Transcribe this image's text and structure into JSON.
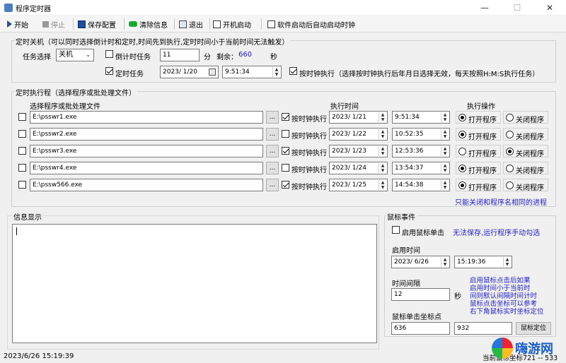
{
  "window": {
    "title": "程序定时器",
    "min": "—",
    "max": "☐",
    "close": "✕"
  },
  "toolbar": {
    "start": "开始",
    "stop": "停止",
    "save": "保存配置",
    "clear": "清除信息",
    "exit": "退出",
    "boot_start": "开机启动",
    "auto_start": "软件启动后自动启动时钟"
  },
  "shutdown": {
    "group_label": "定时关机（可以同时选择倒计时和定时,时间先到执行,定时时间小于当前时间无法触发）",
    "task_label": "任务选择",
    "task_value": "关机",
    "countdown_label": "倒计时任务",
    "countdown_value": "11",
    "unit_min": "分",
    "remain_label": "剩余：",
    "remain_value": "660",
    "unit_sec": "秒",
    "timed_label": "定时任务",
    "date": "2023/ 1/20",
    "time": "9:51:34",
    "clock_exec_label": "按时钟执行（选择按时钟执行后年月日选择无效，每天按照H:M:S执行任务）"
  },
  "program": {
    "group_label": "定时执行程（选择程序或批处理文件）",
    "col_file": "选择程序或批处理文件",
    "col_time": "执行时间",
    "col_action": "执行操作",
    "browse": "...",
    "clock_label": "按时钟执行",
    "open_label": "打开程序",
    "close_label": "关闭程序",
    "rows": [
      {
        "path": "E:\\psswr1.exe",
        "clock": true,
        "date": "2023/ 1/21",
        "time": "9:51:34",
        "action": "open"
      },
      {
        "path": "E:\\psswr2.exe",
        "clock": false,
        "date": "2023/ 1/22",
        "time": "10:52:35",
        "action": "open"
      },
      {
        "path": "E:\\psswr3.exe",
        "clock": true,
        "date": "2023/ 1/23",
        "time": "12:53:36",
        "action": "close"
      },
      {
        "path": "E:\\psswr4.exe",
        "clock": false,
        "date": "2023/ 1/24",
        "time": "13:54:37",
        "action": "open"
      },
      {
        "path": "E:\\pssw566.exe",
        "clock": true,
        "date": "2023/ 1/25",
        "time": "14:54:38",
        "action": "open"
      }
    ],
    "note": "只能关闭和程序名相同的进程"
  },
  "info": {
    "label": "信息显示"
  },
  "mouse": {
    "group_label": "鼠标事件",
    "enable_label": "启用鼠标单击",
    "enable_note": "无法保存,运行程序手动勾选",
    "start_time_label": "启用时间",
    "date": "2023/ 6/26",
    "time": "15:19:36",
    "interval_label": "时间间隔",
    "interval_value": "12",
    "unit_sec": "秒",
    "hint": [
      "启用鼠标点击后如果",
      "启用时间小于当前时",
      "间则默认间隔时间计时",
      "鼠标点击坐标可以参考",
      "右下角鼠标实时坐标定位"
    ],
    "coord_label": "鼠标单击坐标点",
    "x": "636",
    "y": "932",
    "locate_btn": "鼠标定位"
  },
  "status": {
    "datetime": "2023/6/26 15:19:39",
    "coords": "当前鼠标坐标721 -- 533"
  },
  "watermark": "嗨游网"
}
